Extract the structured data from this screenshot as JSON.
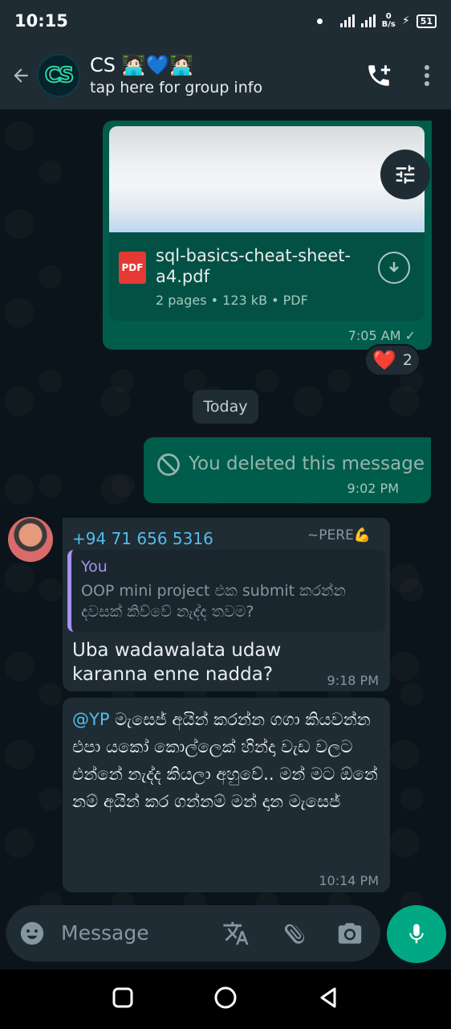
{
  "status": {
    "time": "10:15",
    "speed_top": "0",
    "speed_bottom": "B/s",
    "battery": "51"
  },
  "header": {
    "group_name": "CS 🧑🏻‍💻💙🧑🏻‍💻",
    "avatar_text": "CS",
    "subtitle": "tap here for group info"
  },
  "messages": {
    "doc": {
      "file_name": "sql-basics-cheat-sheet-a4.pdf",
      "file_badge": "PDF",
      "meta": "2 pages • 123 kB • PDF",
      "time": "7:05 AM ✓",
      "reaction_count": "2",
      "reaction_emoji": "❤️"
    },
    "date_separator": "Today",
    "deleted": {
      "text": "You deleted this message",
      "time": "9:02 PM"
    },
    "reply": {
      "sender": "+94 71 656 5316",
      "alias": "~PERE💪",
      "quote_name": "You",
      "quote_text": "OOP mini project එක submit කරන්න දවසක් කිව්වේ නැද්ද තවම?",
      "text": "Uba wadawalata udaw karanna enne nadda?",
      "time": "9:18 PM"
    },
    "long": {
      "mention": "@YP",
      "text": " මැසෙජ් අයින් කරන්න ගගා කියවන්න එපා යකෝ කොල්ලෙක් හින්දා වැඩ වලට එන්නේ නැද්ද කියලා අහුවේ.. මන් මට ඕනේ නම් අයින් කර ගන්නම් මන් දාන මැසෙජ්",
      "time": "10:14 PM"
    }
  },
  "composer": {
    "placeholder": "Message"
  },
  "colors": {
    "outgoing": "#005c4b",
    "incoming": "#1f2c34",
    "accent": "#00a884",
    "mention": "#53bdeb"
  },
  "icons": [
    "back-arrow-icon",
    "add-call-icon",
    "more-vert-icon",
    "tune-icon",
    "download-icon",
    "block-icon",
    "emoji-icon",
    "translate-icon",
    "attach-icon",
    "camera-icon",
    "mic-icon",
    "nav-square-icon",
    "nav-circle-icon",
    "nav-back-icon"
  ]
}
